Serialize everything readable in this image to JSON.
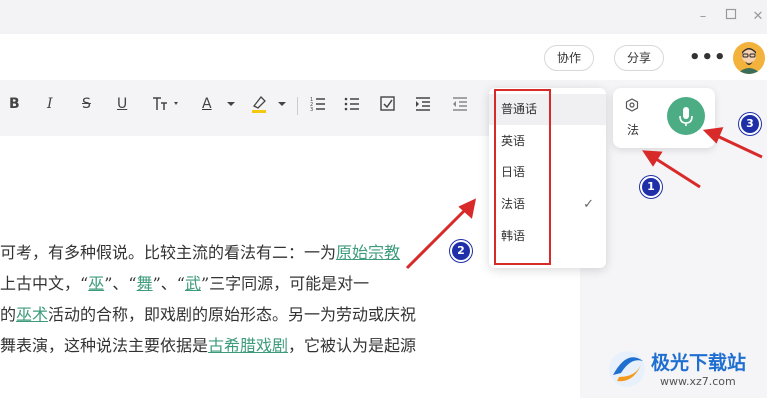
{
  "header": {
    "collab_label": "协作",
    "share_label": "分享",
    "more_label": "•••"
  },
  "toolbar": {
    "bold": "B",
    "italic": "I",
    "strike": "S",
    "underline": "U",
    "font_color_letter": "A"
  },
  "language_menu": {
    "items": [
      {
        "label": "普通话",
        "selected": false
      },
      {
        "label": "英语",
        "selected": false
      },
      {
        "label": "日语",
        "selected": false
      },
      {
        "label": "法语",
        "selected": true
      },
      {
        "label": "韩语",
        "selected": false
      }
    ]
  },
  "voice_panel": {
    "language_label": "法"
  },
  "document": {
    "line1": {
      "a": "可考，有多种假说。比较主流的看法有二：一为",
      "link": "原始宗教"
    },
    "line2": {
      "a": "上古中文，“",
      "l1": "巫",
      "b": "”、“",
      "l2": "舞",
      "c": "”、“",
      "l3": "武",
      "d": "”三字同源，可能是对一"
    },
    "line3": {
      "a": "的",
      "link": "巫术",
      "b": "活动的合称，即戏剧的原始形态。另一为劳动或庆祝"
    },
    "line4": {
      "a": "舞表演，这种说法主要依据是",
      "link": "古希腊戏剧",
      "b": "，它被认为是起源"
    }
  },
  "annotations": {
    "badge1": "1",
    "badge2": "2",
    "badge3": "3"
  },
  "watermark": {
    "name": "极光下载站",
    "url": "www.xz7.com"
  },
  "colors": {
    "accent": "#4cad84",
    "link": "#3e9b7b",
    "highlight_red": "#d92a2a",
    "badge_blue": "#1e2fa8"
  }
}
